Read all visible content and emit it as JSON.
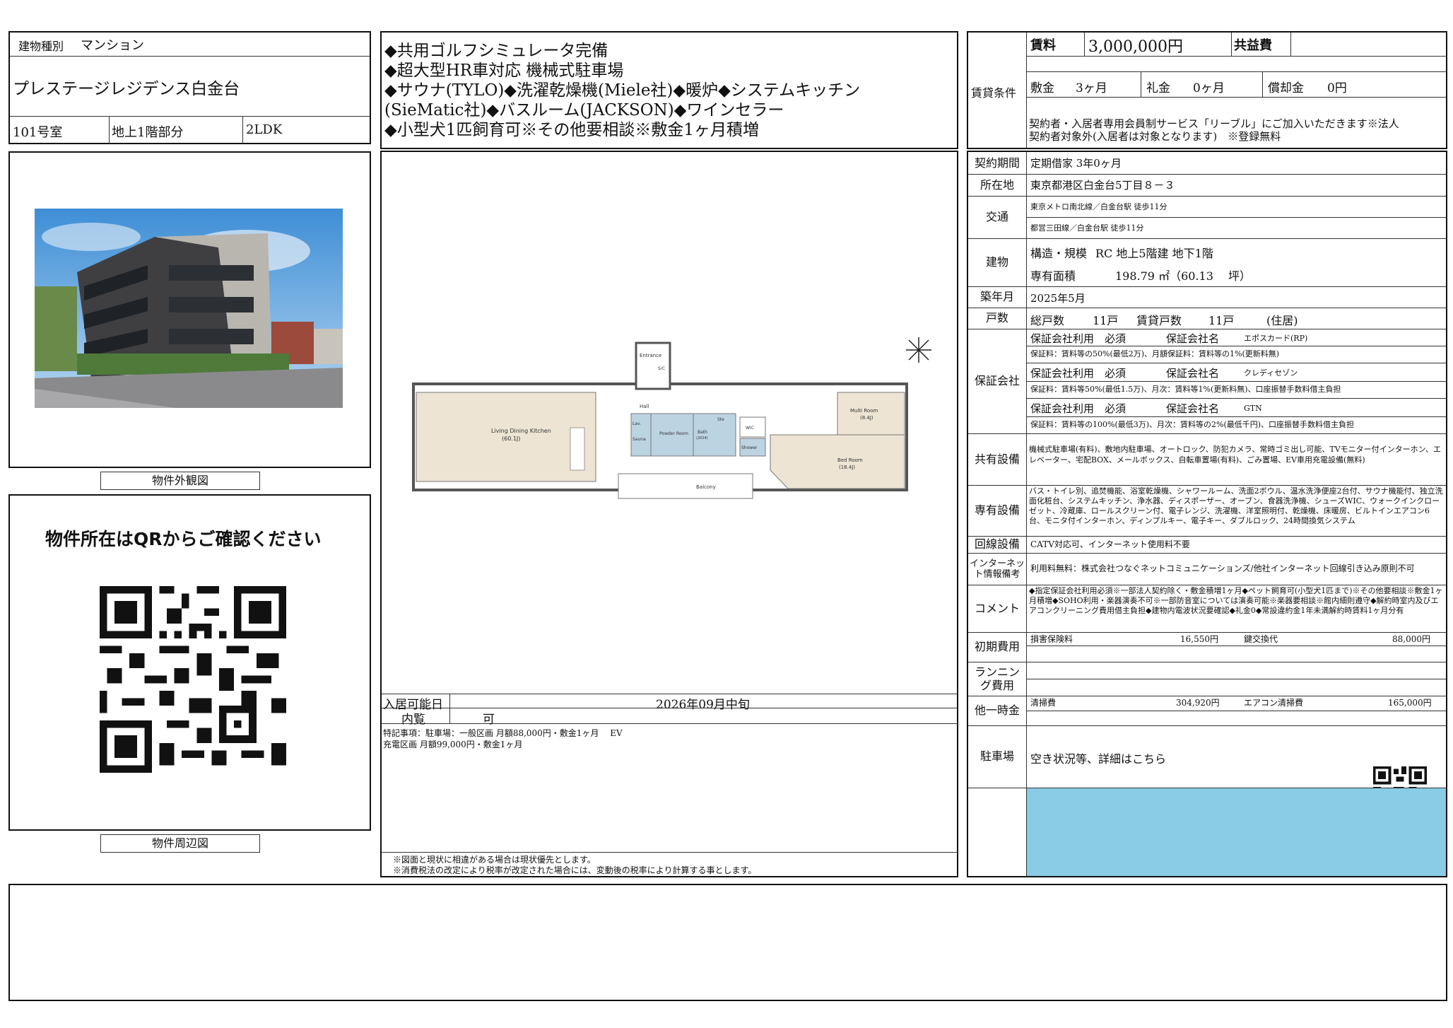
{
  "left": {
    "building_type_label": "建物種別",
    "building_type_value": "マンション",
    "property_name": "プレステージレジデンス白金台",
    "room_no": "101号室",
    "floor": "地上1階部分",
    "layout": "2LDK",
    "exterior_caption": "物件外観図",
    "qr_heading": "物件所在はQRからご確認ください",
    "surroundings_caption": "物件周辺図"
  },
  "features": [
    "◆共用ゴルフシミュレータ完備",
    "◆超大型HR車対応 機械式駐車場",
    "◆サウナ(TYLO)◆洗濯乾燥機(Miele社)◆暖炉◆システムキッチン",
    "(SieMatic社)◆バスルーム(JACKSON)◆ワインセラー",
    "◆小型犬1匹飼育可※その他要相談※敷金1ヶ月積増"
  ],
  "floorplan": {
    "living": "Living Dining Kitchen",
    "living_size": "(60.1J)",
    "multi_room": "Multi Room",
    "multi_size": "(8.4J)",
    "bed_room": "Bed Room",
    "bed_size": "(18.4J)",
    "entrance": "Entrance",
    "sic": "S/C",
    "hall": "Hall",
    "lav": "Lav.",
    "sauna": "Sauna",
    "powder": "Powder Room",
    "bath": "Bath",
    "bath_size": "(2024)",
    "wic": "WIC",
    "shower": "Shower",
    "balcony": "Balcony",
    "wine": "Wine Cellar",
    "ste": "Ste"
  },
  "move_in": {
    "label": "入居可能日",
    "value": "2026年09月中旬",
    "viewing_label": "内覧",
    "viewing_value": "可"
  },
  "special_notes": [
    "特記事項：駐車場：一般区画 月額88,000円・敷金1ヶ月　 EV",
    "充電区画 月額99,000円・敷金1ヶ月"
  ],
  "disclaimers": [
    "※図面と現状に相違がある場合は現状優先とします。",
    "※消費税法の改定により税率が改定された場合には、変動後の税率により計算する事とします。"
  ],
  "rent": {
    "section_label": "賃貸条件",
    "rent_label": "賃料",
    "rent_value": "3,000,000円",
    "common_label": "共益費",
    "common_value": "",
    "deposit_label": "敷金",
    "deposit_value": "3ヶ月",
    "key_label": "礼金",
    "key_value": "0ヶ月",
    "amort_label": "償却金",
    "amort_value": "0円",
    "note_line1": "契約者・入居者専用会員制サービス「リーブル」にご加入いただきます※法人",
    "note_line2": "契約者対象外(入居者は対象となります)　※登録無料"
  },
  "details": {
    "term_label": "契約期間",
    "term_value": "定期借家 3年0ヶ月",
    "address_label": "所在地",
    "address_value": "東京都港区白金台5丁目８－３",
    "transport_label": "交通",
    "transport_1": "東京メトロ南北線／白金台駅 徒歩11分",
    "transport_2": "都営三田線／白金台駅 徒歩11分",
    "building_label": "建物",
    "structure_label": "構造・規模",
    "structure_value": "RC 地上5階建 地下1階",
    "area_label": "専有面積",
    "area_value": "198.79 ㎡（60.13　 坪）",
    "built_label": "築年月",
    "built_value": "2025年5月",
    "units_label": "戸数",
    "units_total_label": "総戸数",
    "units_total": "11戸",
    "units_rent_label": "賃貸戸数",
    "units_rent": "11戸",
    "units_note": "(住居)",
    "guarantee_label": "保証会社",
    "guarantors": [
      {
        "use": "保証会社利用　必須",
        "name_label": "保証会社名",
        "name": "エポスカード(RP)",
        "fee": "保証料：賃料等の50%(最低2万)、月額保証料：賃料等の1%(更新料無)"
      },
      {
        "use": "保証会社利用　必須",
        "name_label": "保証会社名",
        "name": "クレディセゾン",
        "fee": "保証料：賃料等50%(最低1.5万)、月次：賃料等1%(更新料無)、口座振替手数料借主負担"
      },
      {
        "use": "保証会社利用　必須",
        "name_label": "保証会社名",
        "name": "GTN",
        "fee": "保証料：賃料等の100%(最低3万)、月次：賃料等の2%(最低千円)、口座振替手数料借主負担"
      }
    ],
    "common_facilities_label": "共有設備",
    "common_facilities": "機械式駐車場(有料)、敷地内駐車場、オートロック、防犯カメラ、常時ゴミ出し可能、TVモニター付インターホン、エレベーター、宅配BOX、メールボックス、自転車置場(有料)、ごみ置場、EV車用充電設備(無料)",
    "private_facilities_label": "専有設備",
    "private_facilities": "バス・トイレ別、追焚機能、浴室乾燥機、シャワールーム、洗面2ボウル、温水洗浄便座2台付、サウナ機能付、独立洗面化粧台、システムキッチン、浄水器、ディスポーザー、オーブン、食器洗浄機、シューズWIC、ウォークインクローゼット、冷蔵庫、ロールスクリーン付、電子レンジ、洗濯機、洋室照明付、乾燥機、床暖房、ビルトインエアコン6台、モニタ付インターホン、ディンプルキー、電子キー、ダブルロック、24時間換気システム",
    "line_label": "回線設備",
    "line_value": "CATV対応可、インターネット使用料不要",
    "internet_label": "インターネット情報備考",
    "internet_value": "利用料無料：株式会社つなぐネットコミュニケーションズ/他社インターネット回線引き込み原則不可",
    "comment_label": "コメント",
    "comment_value": "◆指定保証会社利用必須※一部法人契約除く・敷金積増1ヶ月◆ペット飼育可(小型犬1匹まで)※その他要相談※敷金1ヶ月積増◆SOHO利用・楽器演奏不可※一部防音室については演奏可能※楽器要相談※館内細則遵守◆解約時室内及びエアコンクリーニング費用借主負担◆建物内電波状況要確認◆礼金0◆常設違約金1年未満解約時賃料1ヶ月分有",
    "initial_label": "初期費用",
    "insurance_label": "損害保険料",
    "insurance_value": "16,550円",
    "key_change_label": "鍵交換代",
    "key_change_value": "88,000円",
    "running_label": "ランニング費用",
    "onetime_label": "他一時金",
    "cleaning_label": "清掃費",
    "cleaning_value": "304,920円",
    "ac_label": "エアコン清掃費",
    "ac_value": "165,000円",
    "parking_label": "駐車場",
    "parking_value": "空き状況等、詳細はこちら"
  },
  "colors": {
    "accent_block": "#8acbe6",
    "bath_blue": "#bcd3e2",
    "floor_beige": "#ede4d3"
  }
}
